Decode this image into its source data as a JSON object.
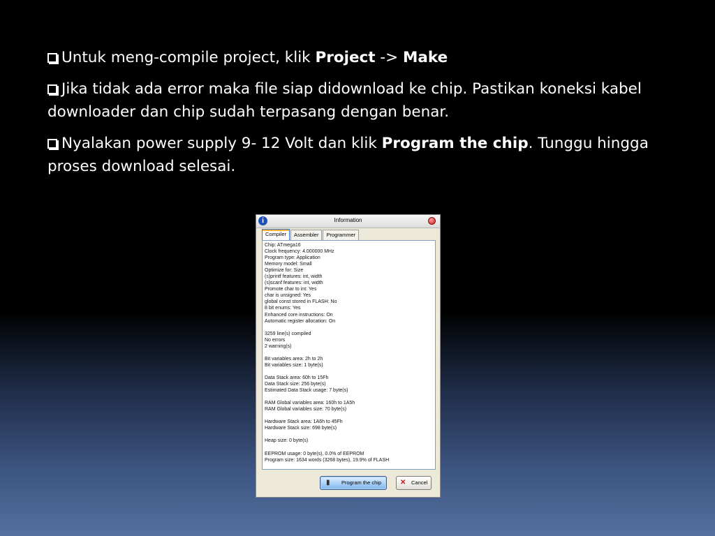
{
  "bullets": [
    {
      "prefix": "Untuk meng-compile project, klik ",
      "bold1": "Project",
      "mid": " -> ",
      "bold2": "Make",
      "suffix": ""
    },
    {
      "text": "Jika tidak ada error maka file siap didownload ke chip. Pastikan koneksi kabel downloader dan chip sudah terpasang dengan benar."
    },
    {
      "prefix": "Nyalakan power supply 9- 12 Volt dan klik ",
      "bold1": "Program the chip",
      "suffix": ". Tunggu hingga proses download selesai."
    }
  ],
  "window": {
    "title": "Information",
    "tabs": [
      "Compiler",
      "Assembler",
      "Programmer"
    ],
    "active_tab": "Compiler",
    "output_lines": [
      "Chip: ATmega16",
      "Clock frequency: 4.000000 MHz",
      "Program type: Application",
      "Memory model: Small",
      "Optimize for: Size",
      "(s)printf features: int, width",
      "(s)scanf features: int, width",
      "Promote char to int: Yes",
      "char is unsigned: Yes",
      "global const stored in FLASH: No",
      "8 bit enums: Yes",
      "Enhanced core instructions: On",
      "Automatic register allocation: On",
      "",
      "3259 line(s) compiled",
      "No errors",
      "2 warning(s)",
      "",
      "Bit variables area: 2h to 2h",
      "Bit variables size: 1 byte(s)",
      "",
      "Data Stack area: 60h to 15Fh",
      "Data Stack size: 256 byte(s)",
      "Estimated Data Stack usage: 7 byte(s)",
      "",
      "RAM Global variables area: 160h to 1A5h",
      "RAM Global variables size: 70 byte(s)",
      "",
      "Hardware Stack area: 1A6h to 45Fh",
      "Hardware Stack size: 698 byte(s)",
      "",
      "Heap size: 0 byte(s)",
      "",
      "EEPROM usage: 0 byte(s), 0.0% of EEPROM",
      "Program size: 1634 words (3268 bytes), 19.9% of FLASH"
    ],
    "program_button": "Program the chip",
    "cancel_button": "Cancel"
  }
}
